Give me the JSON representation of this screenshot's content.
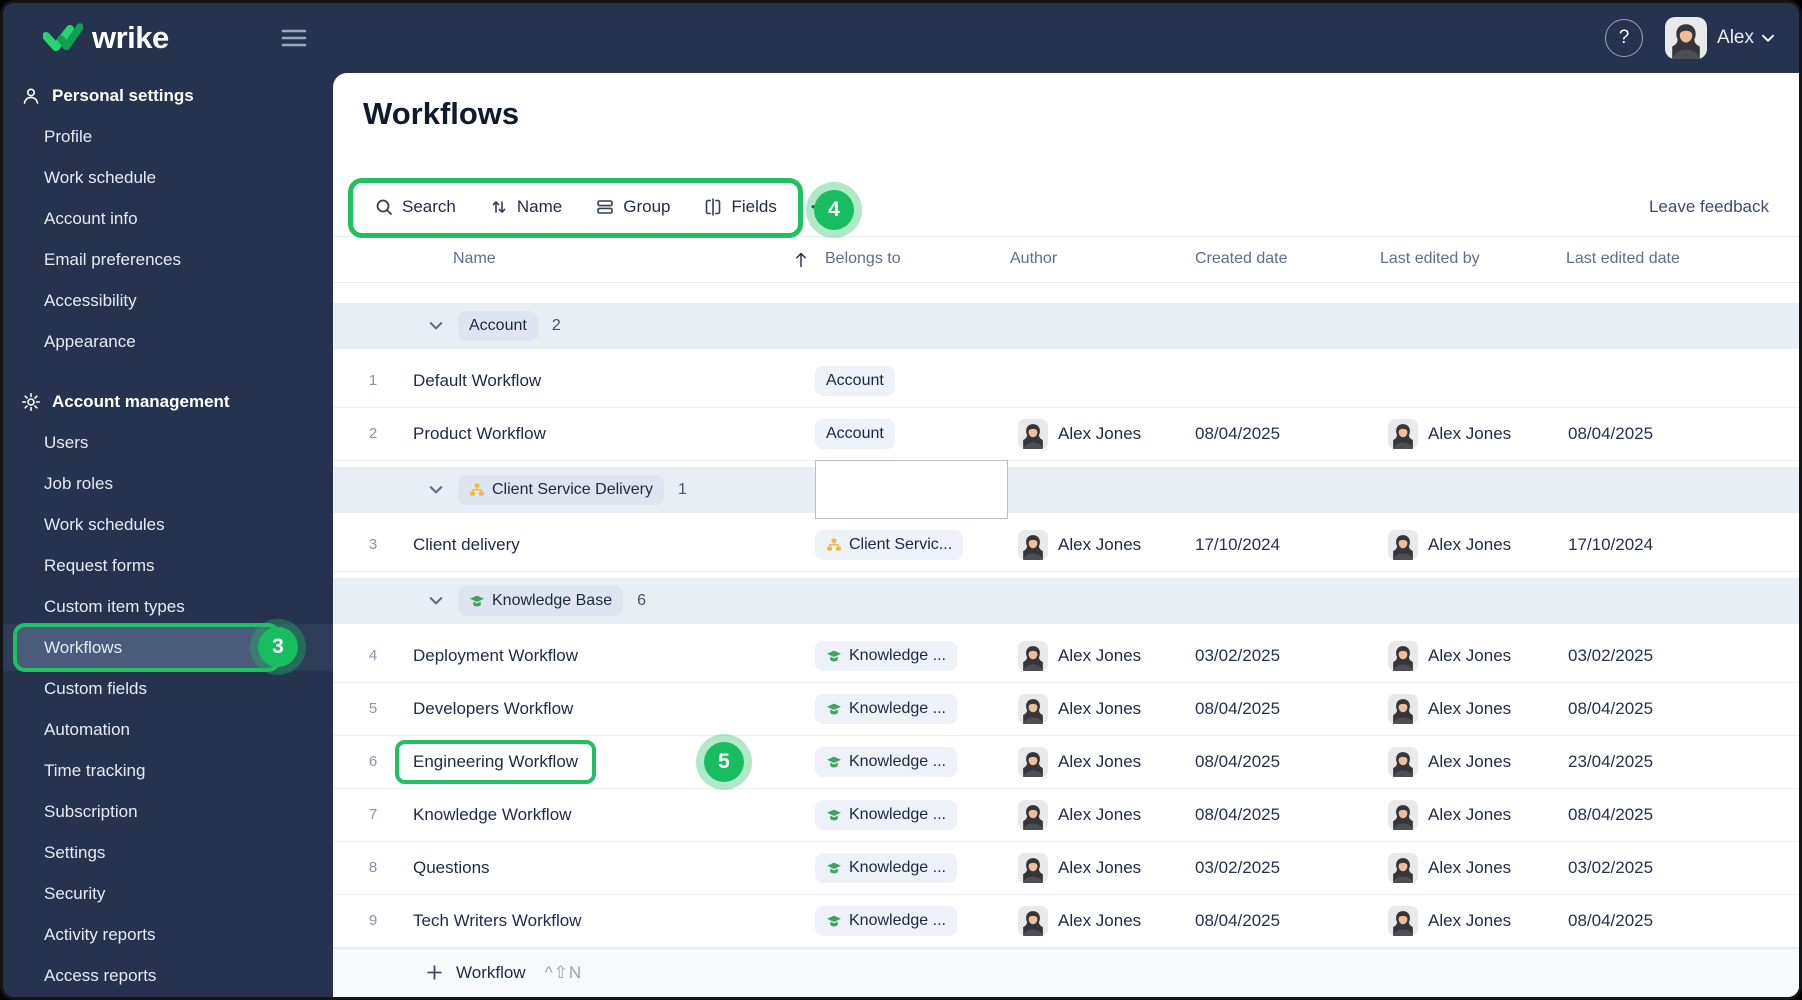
{
  "topbar": {
    "brand": "wrike",
    "user": "Alex",
    "help": "?"
  },
  "sidebar": {
    "personal": {
      "title": "Personal settings",
      "items": [
        "Profile",
        "Work schedule",
        "Account info",
        "Email preferences",
        "Accessibility",
        "Appearance"
      ]
    },
    "account": {
      "title": "Account management",
      "items": [
        "Users",
        "Job roles",
        "Work schedules",
        "Request forms",
        "Custom item types",
        "Workflows",
        "Custom fields",
        "Automation",
        "Time tracking",
        "Subscription",
        "Settings",
        "Security",
        "Activity reports",
        "Access reports"
      ]
    },
    "selected_item": "Workflows"
  },
  "annotations": {
    "step3": "3",
    "step4": "4",
    "step5": "5"
  },
  "main": {
    "title": "Workflows",
    "toolbar": {
      "search": "Search",
      "sort": "Name",
      "group": "Group",
      "fields": "Fields",
      "more": "•••"
    },
    "feedback": "Leave feedback",
    "columns": {
      "name": "Name",
      "belongs": "Belongs to",
      "author": "Author",
      "created": "Created date",
      "edited_by": "Last edited by",
      "edited": "Last edited date"
    },
    "groups": [
      {
        "label": "Account",
        "count": "2",
        "icon": "none"
      },
      {
        "label": "Client Service Delivery",
        "count": "1",
        "icon": "org-chart-icon"
      },
      {
        "label": "Knowledge Base",
        "count": "6",
        "icon": "graduation-cap-icon"
      }
    ],
    "rows": [
      {
        "num": "1",
        "name": "Default Workflow",
        "belongs": "Account",
        "author": "",
        "created": "",
        "edited_by": "",
        "edited": ""
      },
      {
        "num": "2",
        "name": "Product Workflow",
        "belongs": "Account",
        "author": "Alex Jones",
        "created": "08/04/2025",
        "edited_by": "Alex Jones",
        "edited": "08/04/2025"
      },
      {
        "num": "3",
        "name": "Client delivery",
        "belongs": "Client Servic...",
        "author": "Alex Jones",
        "created": "17/10/2024",
        "edited_by": "Alex Jones",
        "edited": "17/10/2024"
      },
      {
        "num": "4",
        "name": "Deployment Workflow",
        "belongs": "Knowledge ...",
        "author": "Alex Jones",
        "created": "03/02/2025",
        "edited_by": "Alex Jones",
        "edited": "03/02/2025"
      },
      {
        "num": "5",
        "name": "Developers Workflow",
        "belongs": "Knowledge ...",
        "author": "Alex Jones",
        "created": "08/04/2025",
        "edited_by": "Alex Jones",
        "edited": "08/04/2025"
      },
      {
        "num": "6",
        "name": "Engineering Workflow",
        "belongs": "Knowledge ...",
        "author": "Alex Jones",
        "created": "08/04/2025",
        "edited_by": "Alex Jones",
        "edited": "23/04/2025"
      },
      {
        "num": "7",
        "name": "Knowledge Workflow",
        "belongs": "Knowledge ...",
        "author": "Alex Jones",
        "created": "08/04/2025",
        "edited_by": "Alex Jones",
        "edited": "08/04/2025"
      },
      {
        "num": "8",
        "name": "Questions",
        "belongs": "Knowledge ...",
        "author": "Alex Jones",
        "created": "03/02/2025",
        "edited_by": "Alex Jones",
        "edited": "03/02/2025"
      },
      {
        "num": "9",
        "name": "Tech Writers Workflow",
        "belongs": "Knowledge ...",
        "author": "Alex Jones",
        "created": "08/04/2025",
        "edited_by": "Alex Jones",
        "edited": "08/04/2025"
      }
    ],
    "footer": {
      "add": "Workflow",
      "shortcut": "^⇧N"
    }
  },
  "colors": {
    "accent_green": "#1EC061",
    "navy": "#26334E",
    "pill_bg": "#EEF1F8",
    "group_row_bg": "#E9EDF4"
  }
}
